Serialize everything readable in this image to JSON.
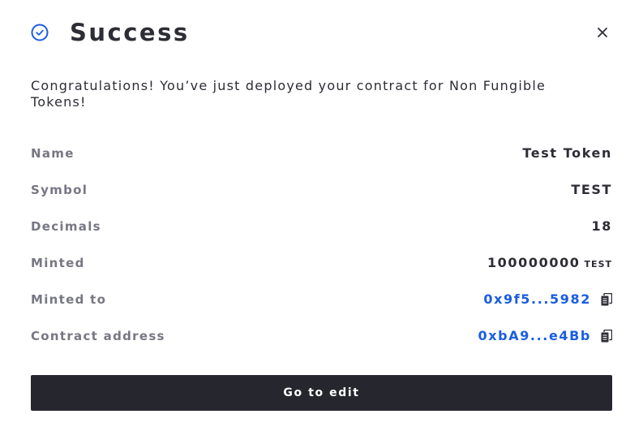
{
  "dialog": {
    "title": "Success",
    "icon": "check-circle-icon",
    "close_icon": "close-icon",
    "accent_color": "#1a5de2",
    "message": "Congratulations! You’ve just deployed your contract for Non Fungible Tokens!"
  },
  "details": {
    "name": {
      "label": "Name",
      "value": "Test Token"
    },
    "symbol": {
      "label": "Symbol",
      "value": "TEST"
    },
    "decimals": {
      "label": "Decimals",
      "value": "18"
    },
    "minted": {
      "label": "Minted",
      "value": "100000000",
      "unit": "TEST"
    },
    "minted_to": {
      "label": "Minted to",
      "value": "0x9f5...5982",
      "icon": "copy-icon"
    },
    "contract_address": {
      "label": "Contract address",
      "value": "0xbA9...e4Bb",
      "icon": "copy-icon"
    }
  },
  "actions": {
    "primary_label": "Go to edit"
  }
}
